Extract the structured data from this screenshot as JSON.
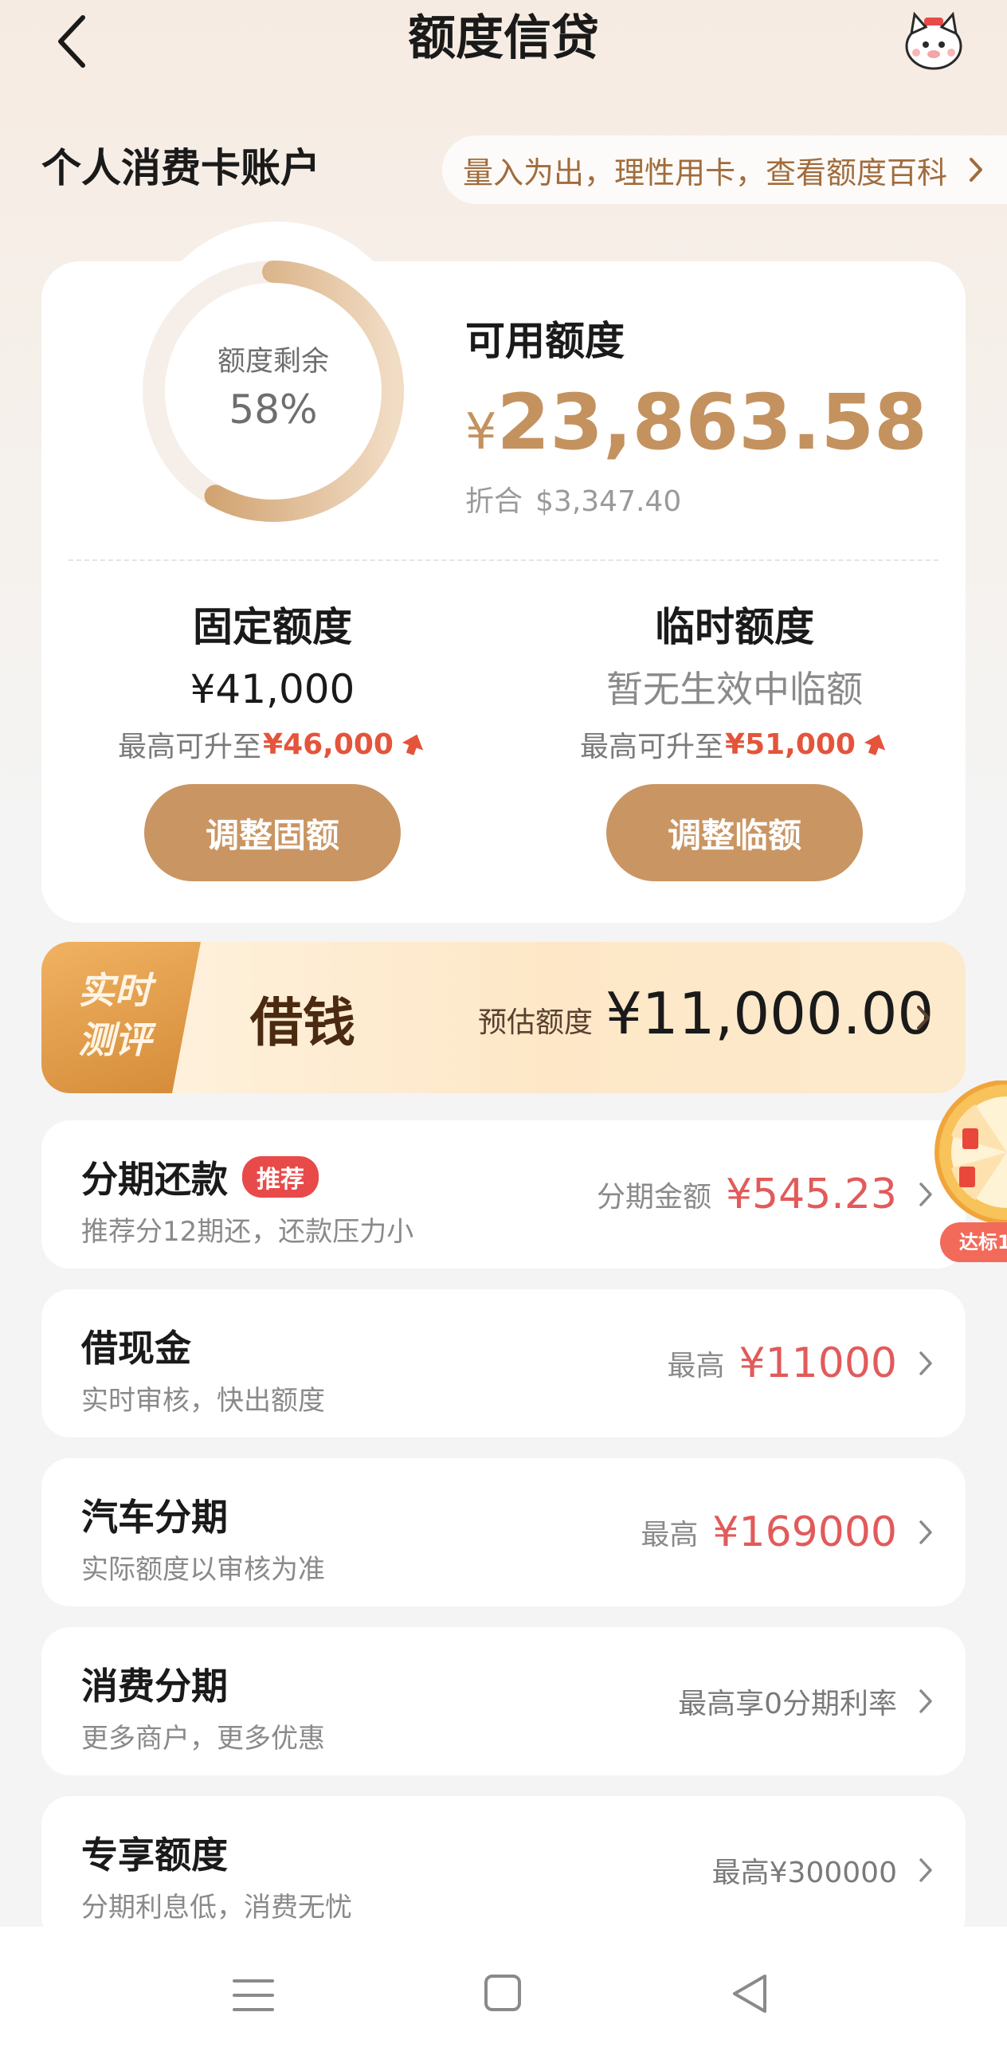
{
  "header": {
    "title": "额度信贷"
  },
  "account": {
    "section_title": "个人消费卡账户",
    "notice": "量入为出，理性用卡，查看额度百科"
  },
  "credit": {
    "ring_label": "额度剩余",
    "ring_percent_text": "58%",
    "ring_fraction": 0.58,
    "available_title": "可用额度",
    "available_currency": "¥",
    "available_amount": "23,863.58",
    "converted_label": "折合",
    "converted_amount": "$3,347.40",
    "fixed": {
      "title": "固定额度",
      "value": "¥41,000",
      "up_label": "最高可升至",
      "up_value": "¥46,000",
      "button": "调整固额"
    },
    "temp": {
      "title": "临时额度",
      "value": "暂无生效中临额",
      "up_label": "最高可升至",
      "up_value": "¥51,000",
      "button": "调整临额"
    }
  },
  "borrow": {
    "tag_line1": "实时",
    "tag_line2": "测评",
    "title": "借钱",
    "estimate_label": "预估额度",
    "estimate_amount": "¥11,000.00"
  },
  "items": [
    {
      "title": "分期还款",
      "badge": "推荐",
      "subtitle": "推荐分12期还，还款压力小",
      "label": "分期金额",
      "value": "¥545.23"
    },
    {
      "title": "借现金",
      "subtitle": "实时审核，快出额度",
      "label": "最高",
      "value": "¥11000"
    },
    {
      "title": "汽车分期",
      "subtitle": "实际额度以审核为准",
      "label": "最高",
      "value": "¥169000"
    },
    {
      "title": "消费分期",
      "subtitle": "更多商户，更多优惠",
      "plain": "最高享0分期利率"
    },
    {
      "title": "专享额度",
      "subtitle": "分期利息低，消费无忧",
      "plain": "最高¥300000"
    }
  ],
  "widget": {
    "tag": "达标1"
  },
  "colors": {
    "accent": "#c99563",
    "highlight": "#e25a5a",
    "gold_text": "#c4925f"
  },
  "icons": [
    "back-arrow-icon",
    "mascot-icon",
    "chevron-right-icon",
    "up-arrow-icon",
    "wheel-icon",
    "menu-icon",
    "home-icon",
    "back-triangle-icon"
  ]
}
